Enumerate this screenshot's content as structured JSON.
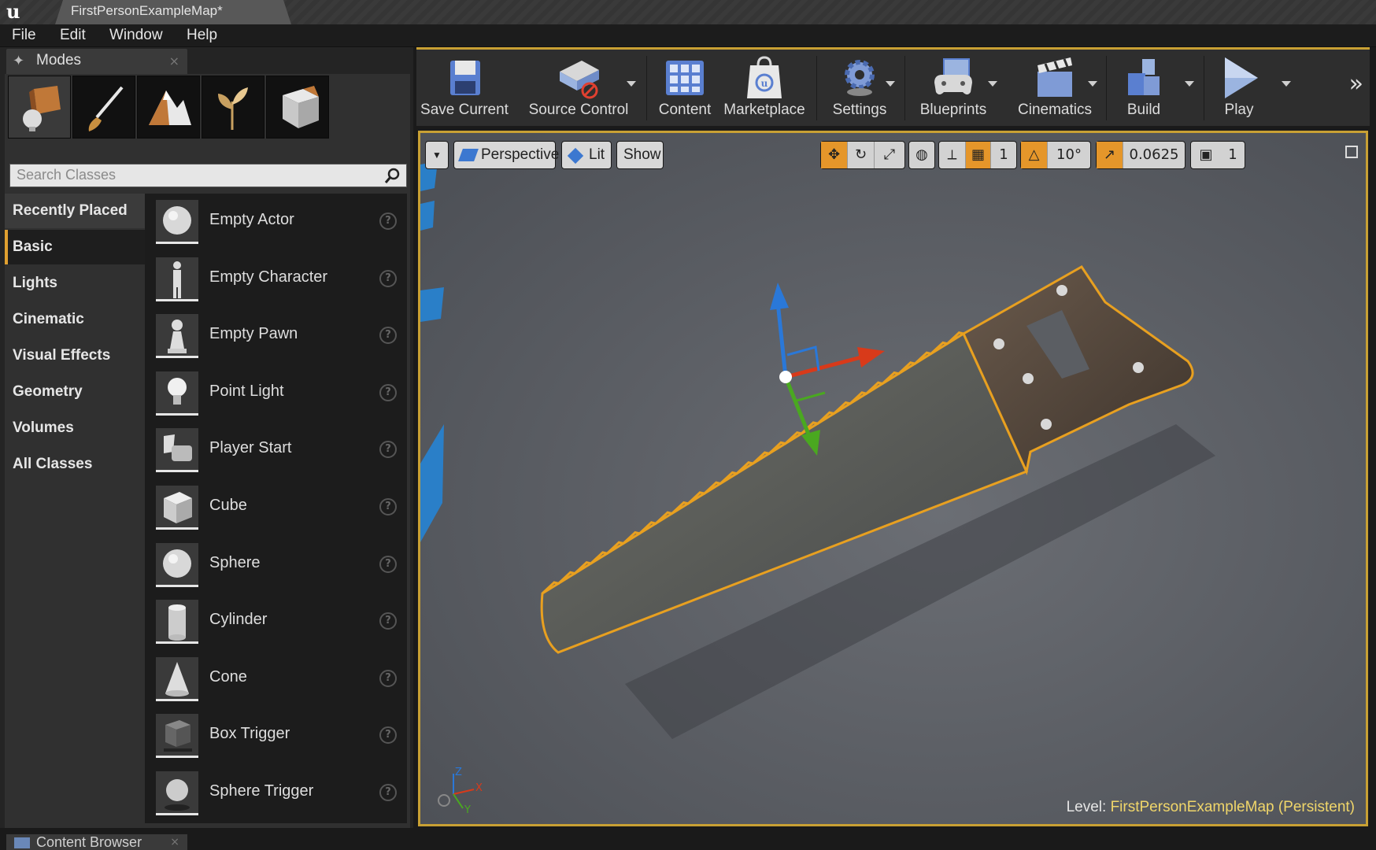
{
  "window": {
    "title": "FirstPersonExampleMap*"
  },
  "menu": [
    "File",
    "Edit",
    "Window",
    "Help"
  ],
  "modes_panel": {
    "tab_label": "Modes",
    "mode_icons": [
      "place-mode-icon",
      "paint-mode-icon",
      "landscape-mode-icon",
      "foliage-mode-icon",
      "geometry-mode-icon"
    ],
    "search_placeholder": "Search Classes",
    "categories": [
      "Recently Placed",
      "Basic",
      "Lights",
      "Cinematic",
      "Visual Effects",
      "Geometry",
      "Volumes",
      "All Classes"
    ],
    "selected_category": "Basic",
    "items": [
      {
        "label": "Empty Actor",
        "icon": "sphere-icon"
      },
      {
        "label": "Empty Character",
        "icon": "character-icon"
      },
      {
        "label": "Empty Pawn",
        "icon": "pawn-icon"
      },
      {
        "label": "Point Light",
        "icon": "light-bulb-icon"
      },
      {
        "label": "Player Start",
        "icon": "player-start-icon"
      },
      {
        "label": "Cube",
        "icon": "cube-icon"
      },
      {
        "label": "Sphere",
        "icon": "sphere-icon"
      },
      {
        "label": "Cylinder",
        "icon": "cylinder-icon"
      },
      {
        "label": "Cone",
        "icon": "cone-icon"
      },
      {
        "label": "Box Trigger",
        "icon": "box-trigger-icon"
      },
      {
        "label": "Sphere Trigger",
        "icon": "sphere-trigger-icon"
      }
    ],
    "help_glyph": "?"
  },
  "toolbar": {
    "save_current": "Save Current",
    "source_control": "Source Control",
    "content": "Content",
    "marketplace": "Marketplace",
    "settings": "Settings",
    "blueprints": "Blueprints",
    "cinematics": "Cinematics",
    "build": "Build",
    "play": "Play",
    "more": "»"
  },
  "viewport": {
    "perspective": "Perspective",
    "lit": "Lit",
    "show": "Show",
    "grid_snap": "1",
    "rotation_snap": "10°",
    "scale_snap": "0.0625",
    "camera_speed": "1",
    "level_prefix": "Level:",
    "level_name": "FirstPersonExampleMap (Persistent)",
    "axis_labels": {
      "z": "Z",
      "x": "X",
      "y": "Y"
    }
  },
  "bottom": {
    "content_browser": "Content Browser",
    "close": "×"
  },
  "colors": {
    "accent": "#c8a034",
    "selection_outline": "#e8a020",
    "x_axis": "#d83a1a",
    "y_axis": "#4aa820",
    "z_axis": "#2a78d8"
  }
}
